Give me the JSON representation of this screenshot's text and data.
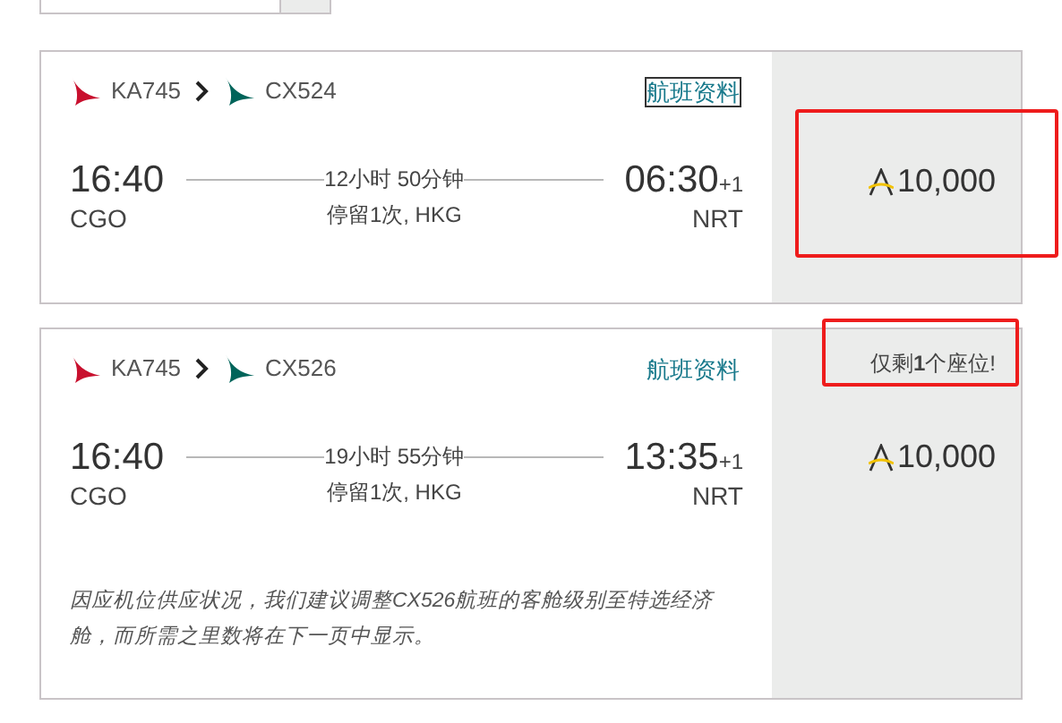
{
  "flights": [
    {
      "segments": [
        {
          "code": "KA745",
          "color": "#c8102e"
        },
        {
          "code": "CX524",
          "color": "#00645a"
        }
      ],
      "details_link": {
        "label": "航班资料",
        "focused": true
      },
      "depart": {
        "time": "16:40",
        "airport": "CGO"
      },
      "duration": "12小时 50分钟",
      "stops": "停留1次, HKG",
      "arrive": {
        "time": "06:30",
        "day_offset": "+1",
        "airport": "NRT"
      },
      "price": {
        "miles": "10,000",
        "highlighted": true
      }
    },
    {
      "segments": [
        {
          "code": "KA745",
          "color": "#c8102e"
        },
        {
          "code": "CX526",
          "color": "#00645a"
        }
      ],
      "details_link": {
        "label": "航班资料",
        "focused": false
      },
      "depart": {
        "time": "16:40",
        "airport": "CGO"
      },
      "duration": "19小时 55分钟",
      "stops": "停留1次, HKG",
      "arrive": {
        "time": "13:35",
        "day_offset": "+1",
        "airport": "NRT"
      },
      "seats_left": {
        "text": "仅剩**1**个座位!",
        "highlighted": true
      },
      "note": "因应机位供应状况，我们建议调整CX526航班的客舱级别至特选经济舱，而所需之里数将在下一页中显示。",
      "price": {
        "miles": "10,000",
        "highlighted": false
      }
    }
  ]
}
